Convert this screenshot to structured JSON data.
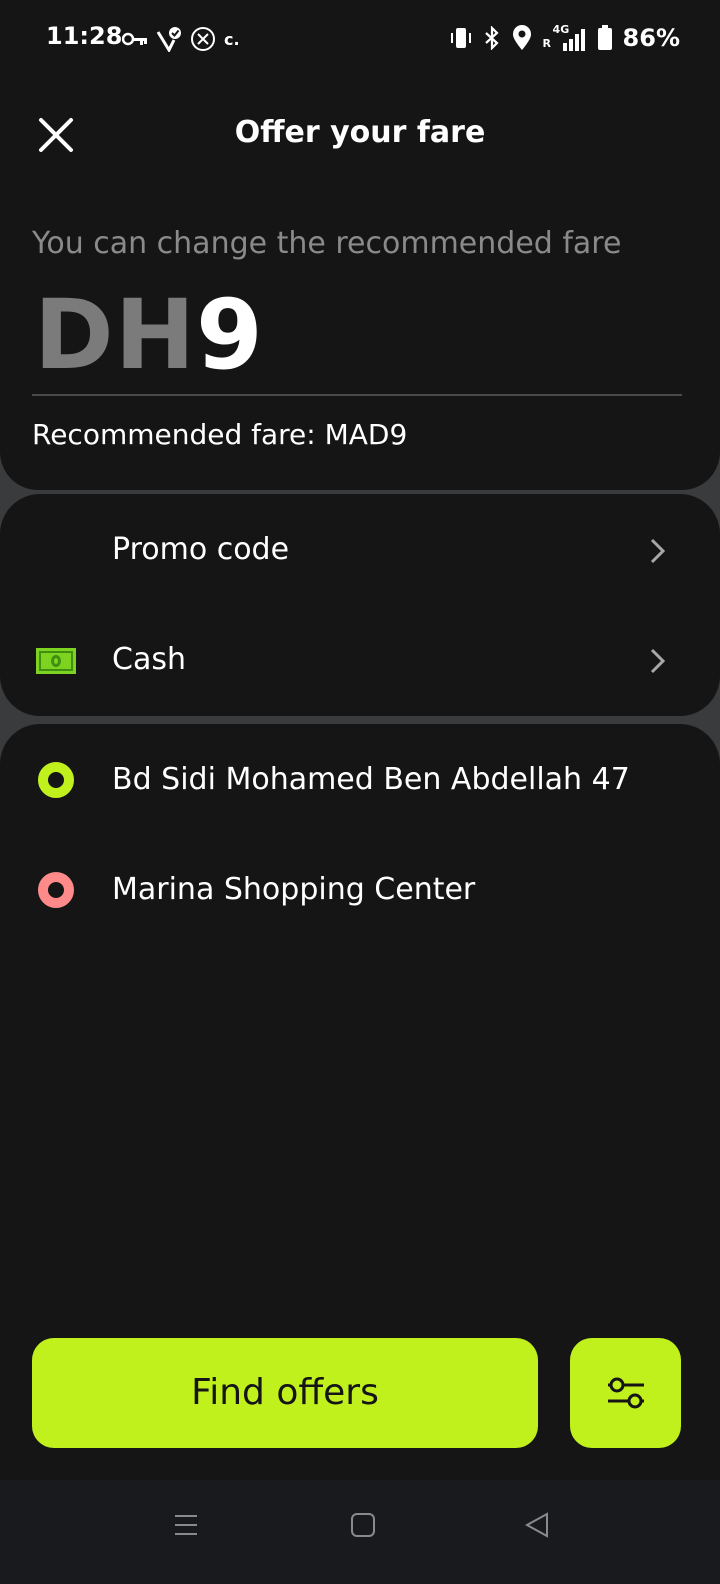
{
  "status_bar": {
    "time": "11:28",
    "battery_percent": "86%",
    "left_icons": [
      "key-icon",
      "check-shield-icon",
      "x-app-icon",
      "c-dot-icon"
    ],
    "right_icons": [
      "vibrate-icon",
      "bluetooth-icon",
      "location-icon",
      "signal-4g-icon",
      "battery-icon"
    ],
    "network_label": "4G",
    "roaming_label": "R",
    "c_label": "c."
  },
  "header": {
    "title": "Offer your fare",
    "close_icon": "close-icon"
  },
  "fare": {
    "hint": "You can change the recommended fare",
    "currency": "DH",
    "amount": "9",
    "recommended": "Recommended fare: MAD9"
  },
  "options": [
    {
      "label": "Promo code",
      "icon": "",
      "chevron": "chevron-right-icon"
    },
    {
      "label": "Cash",
      "icon": "cash-icon",
      "chevron": "chevron-right-icon"
    }
  ],
  "route": {
    "pickup": "Bd Sidi Mohamed Ben Abdellah 47",
    "destination": "Marina Shopping Center",
    "pickup_color": "#c1f11d",
    "destination_color": "#ff8a8a"
  },
  "actions": {
    "find_offers": "Find offers",
    "filter_icon": "sliders-icon"
  },
  "nav": [
    "menu-icon",
    "home-icon",
    "back-icon"
  ],
  "colors": {
    "accent": "#c1f11d",
    "background": "#151515",
    "muted_text": "#8a8a8a"
  }
}
